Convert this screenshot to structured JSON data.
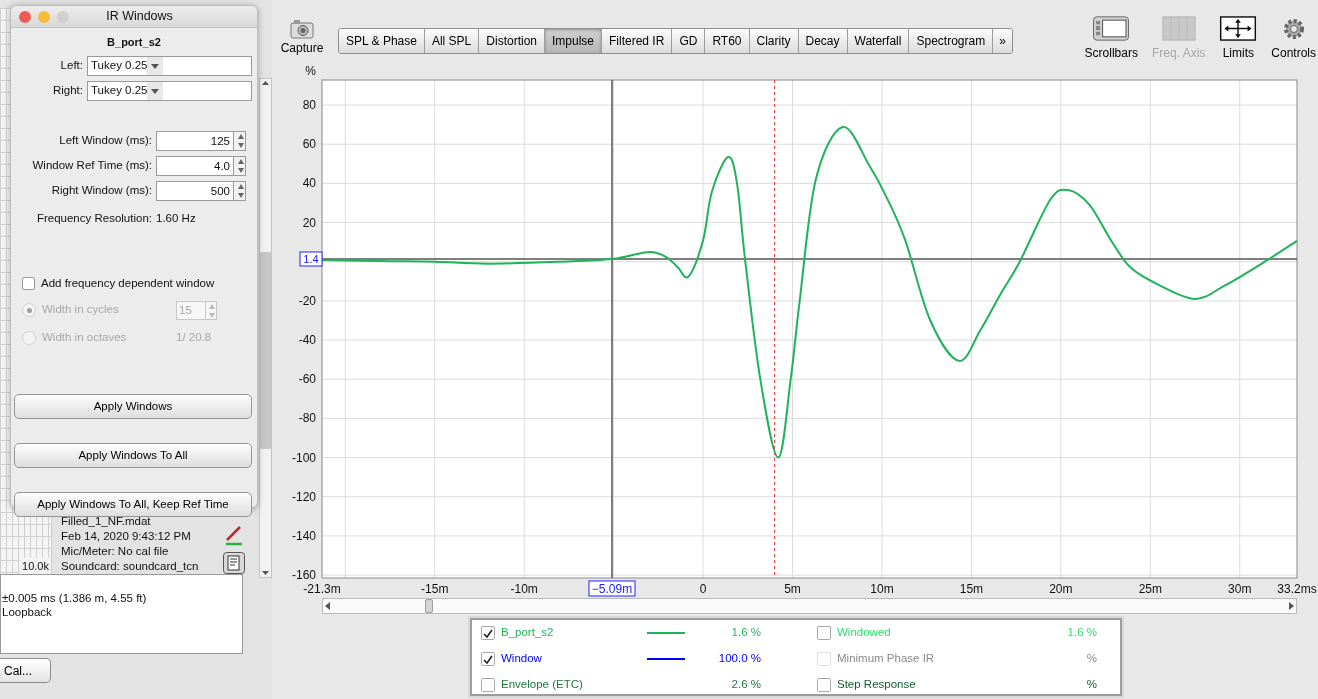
{
  "dialog": {
    "title": "IR Windows",
    "measurement": "B_port_s2",
    "selects": [
      {
        "label": "Left:",
        "value": "Tukey 0.25"
      },
      {
        "label": "Right:",
        "value": "Tukey 0.25"
      }
    ],
    "spinners": [
      {
        "label": "Left Window (ms):",
        "value": "125"
      },
      {
        "label": "Window Ref Time (ms):",
        "value": "4.0"
      },
      {
        "label": "Right Window (ms):",
        "value": "500"
      }
    ],
    "frequency_resolution": {
      "label": "Frequency Resolution:",
      "value": "1.60 Hz"
    },
    "frequency_dependent": {
      "label": "Add frequency dependent window",
      "checked": false
    },
    "width_options": [
      {
        "label": "Width in cycles",
        "selected": true,
        "disabled": true,
        "kind": "spinner",
        "value": "15"
      },
      {
        "label": "Width in octaves",
        "selected": false,
        "disabled": true,
        "kind": "text",
        "value": "1/ 20.8"
      }
    ],
    "buttons": [
      "Apply Windows",
      "Apply Windows To All",
      "Apply Windows To All, Keep Ref Time"
    ]
  },
  "left_panel": {
    "axis_label": "10.0k",
    "info_lines": [
      "Filled_1_NF.mdat",
      "Feb 14, 2020 9:43:12 PM",
      "Mic/Meter: No cal file",
      "Soundcard: soundcard_tcn"
    ],
    "details_lines": [
      "±0.005 ms (1.386 m, 4.55 ft)",
      "Loopback"
    ],
    "button": "Cal..."
  },
  "toolbar": {
    "capture": "Capture",
    "tabs": [
      {
        "label": "SPL & Phase",
        "selected": false
      },
      {
        "label": "All SPL",
        "selected": false
      },
      {
        "label": "Distortion",
        "selected": false
      },
      {
        "label": "Impulse",
        "selected": true
      },
      {
        "label": "Filtered IR",
        "selected": false
      },
      {
        "label": "GD",
        "selected": false
      },
      {
        "label": "RT60",
        "selected": false
      },
      {
        "label": "Clarity",
        "selected": false
      },
      {
        "label": "Decay",
        "selected": false
      },
      {
        "label": "Waterfall",
        "selected": false
      },
      {
        "label": "Spectrogram",
        "selected": false
      }
    ],
    "more": "»",
    "tools": [
      {
        "label": "Scrollbars",
        "kind": "scrollbars",
        "disabled": false
      },
      {
        "label": "Freq. Axis",
        "kind": "freq-axis",
        "disabled": true
      },
      {
        "label": "Limits",
        "kind": "limits",
        "disabled": false
      },
      {
        "label": "Controls",
        "kind": "controls",
        "disabled": false
      }
    ]
  },
  "chart": {
    "chart_data": {
      "type": "line",
      "ylabel": "%",
      "x": [
        -21.3,
        -18,
        -15,
        -12,
        -8,
        -5.09,
        -3,
        -2,
        -1.4,
        -0.8,
        0,
        0.5,
        1.4,
        1.9,
        2.35,
        3.2,
        4.2,
        4.9,
        5.4,
        6.3,
        7.8,
        9.3,
        10.2,
        11.3,
        12.7,
        14.3,
        15.5,
        16.6,
        17.7,
        19.4,
        20.4,
        21.6,
        22.8,
        23.9,
        25.5,
        27.5,
        29.2,
        31.4,
        33.2
      ],
      "series": [
        {
          "color": "#1fb35a",
          "values": [
            0.9,
            0.3,
            0,
            -1,
            0,
            1.4,
            5,
            2,
            -3,
            -7.5,
            11,
            36,
            53.5,
            40,
            1,
            -60,
            -100,
            -60,
            -20,
            42,
            68.8,
            49,
            34,
            11,
            -30,
            -50.6,
            -35,
            -17,
            0,
            31.5,
            36.6,
            29,
            11,
            -3,
            -12,
            -19,
            -12,
            0,
            10.7
          ]
        }
      ],
      "xlim": [
        -21.3,
        33.2
      ],
      "ylim": [
        -161.5,
        92.8
      ],
      "xticks": [
        {
          "value": -21.3,
          "label": "-21.3m"
        },
        {
          "value": -15,
          "label": "-15m"
        },
        {
          "value": -10,
          "label": "-10m"
        },
        {
          "value": 0,
          "label": "0"
        },
        {
          "value": 5,
          "label": "5m"
        },
        {
          "value": 10,
          "label": "10m"
        },
        {
          "value": 15,
          "label": "15m"
        },
        {
          "value": 20,
          "label": "20m"
        },
        {
          "value": 25,
          "label": "25m"
        },
        {
          "value": 30,
          "label": "30m"
        },
        {
          "value": 33.2,
          "label": "33.2ms"
        }
      ],
      "yticks": [
        80,
        60,
        40,
        20,
        -20,
        -40,
        -60,
        -80,
        -100,
        -120,
        -140,
        -160
      ],
      "grid": true,
      "ref_lines": [
        {
          "axis": "x",
          "value": 4.0,
          "color": "#e03030"
        },
        {
          "axis": "x",
          "value": -5.09,
          "label": "−5.09m",
          "color": "#555555"
        },
        {
          "axis": "y",
          "value": 1.4,
          "label": "1.4",
          "color": "#555555"
        }
      ]
    }
  },
  "legend": [
    {
      "name": "B_port_s2",
      "checked": true,
      "disabled": false,
      "color": "#1fb35a",
      "line": true,
      "reading": "1.6 %"
    },
    {
      "name": "Windowed",
      "checked": false,
      "disabled": false,
      "color": "#2ee06a",
      "line": false,
      "reading": "1.6 %"
    },
    {
      "name": "Window",
      "checked": true,
      "disabled": false,
      "color": "#0000ff",
      "line": true,
      "reading": "100.0 %"
    },
    {
      "name": "Minimum Phase IR",
      "checked": false,
      "disabled": true,
      "color": "#8a8a8a",
      "line": false,
      "reading": "%"
    },
    {
      "name": "Envelope (ETC)",
      "checked": false,
      "disabled": false,
      "color": "#1d7a3c",
      "line": false,
      "reading": "2.6 %"
    },
    {
      "name": "Step Response",
      "checked": false,
      "disabled": false,
      "color": "#135c2c",
      "line": false,
      "reading": "%"
    }
  ]
}
